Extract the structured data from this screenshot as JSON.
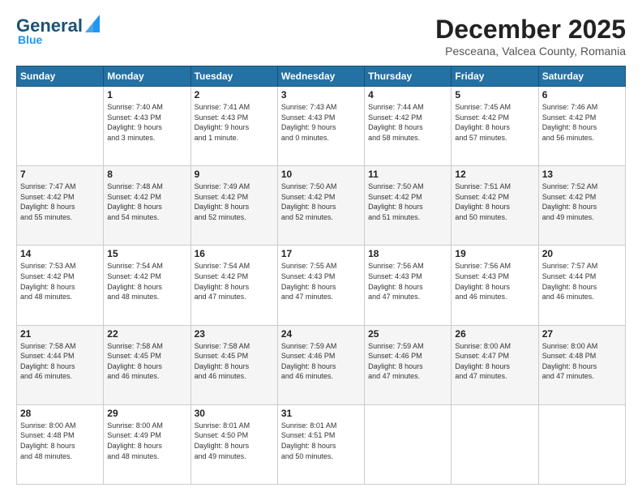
{
  "header": {
    "logo_general": "General",
    "logo_blue": "Blue",
    "month_title": "December 2025",
    "location": "Pesceana, Valcea County, Romania"
  },
  "weekdays": [
    "Sunday",
    "Monday",
    "Tuesday",
    "Wednesday",
    "Thursday",
    "Friday",
    "Saturday"
  ],
  "weeks": [
    [
      {
        "day": "",
        "content": ""
      },
      {
        "day": "1",
        "content": "Sunrise: 7:40 AM\nSunset: 4:43 PM\nDaylight: 9 hours\nand 3 minutes."
      },
      {
        "day": "2",
        "content": "Sunrise: 7:41 AM\nSunset: 4:43 PM\nDaylight: 9 hours\nand 1 minute."
      },
      {
        "day": "3",
        "content": "Sunrise: 7:43 AM\nSunset: 4:43 PM\nDaylight: 9 hours\nand 0 minutes."
      },
      {
        "day": "4",
        "content": "Sunrise: 7:44 AM\nSunset: 4:42 PM\nDaylight: 8 hours\nand 58 minutes."
      },
      {
        "day": "5",
        "content": "Sunrise: 7:45 AM\nSunset: 4:42 PM\nDaylight: 8 hours\nand 57 minutes."
      },
      {
        "day": "6",
        "content": "Sunrise: 7:46 AM\nSunset: 4:42 PM\nDaylight: 8 hours\nand 56 minutes."
      }
    ],
    [
      {
        "day": "7",
        "content": "Sunrise: 7:47 AM\nSunset: 4:42 PM\nDaylight: 8 hours\nand 55 minutes."
      },
      {
        "day": "8",
        "content": "Sunrise: 7:48 AM\nSunset: 4:42 PM\nDaylight: 8 hours\nand 54 minutes."
      },
      {
        "day": "9",
        "content": "Sunrise: 7:49 AM\nSunset: 4:42 PM\nDaylight: 8 hours\nand 52 minutes."
      },
      {
        "day": "10",
        "content": "Sunrise: 7:50 AM\nSunset: 4:42 PM\nDaylight: 8 hours\nand 52 minutes."
      },
      {
        "day": "11",
        "content": "Sunrise: 7:50 AM\nSunset: 4:42 PM\nDaylight: 8 hours\nand 51 minutes."
      },
      {
        "day": "12",
        "content": "Sunrise: 7:51 AM\nSunset: 4:42 PM\nDaylight: 8 hours\nand 50 minutes."
      },
      {
        "day": "13",
        "content": "Sunrise: 7:52 AM\nSunset: 4:42 PM\nDaylight: 8 hours\nand 49 minutes."
      }
    ],
    [
      {
        "day": "14",
        "content": "Sunrise: 7:53 AM\nSunset: 4:42 PM\nDaylight: 8 hours\nand 48 minutes."
      },
      {
        "day": "15",
        "content": "Sunrise: 7:54 AM\nSunset: 4:42 PM\nDaylight: 8 hours\nand 48 minutes."
      },
      {
        "day": "16",
        "content": "Sunrise: 7:54 AM\nSunset: 4:42 PM\nDaylight: 8 hours\nand 47 minutes."
      },
      {
        "day": "17",
        "content": "Sunrise: 7:55 AM\nSunset: 4:43 PM\nDaylight: 8 hours\nand 47 minutes."
      },
      {
        "day": "18",
        "content": "Sunrise: 7:56 AM\nSunset: 4:43 PM\nDaylight: 8 hours\nand 47 minutes."
      },
      {
        "day": "19",
        "content": "Sunrise: 7:56 AM\nSunset: 4:43 PM\nDaylight: 8 hours\nand 46 minutes."
      },
      {
        "day": "20",
        "content": "Sunrise: 7:57 AM\nSunset: 4:44 PM\nDaylight: 8 hours\nand 46 minutes."
      }
    ],
    [
      {
        "day": "21",
        "content": "Sunrise: 7:58 AM\nSunset: 4:44 PM\nDaylight: 8 hours\nand 46 minutes."
      },
      {
        "day": "22",
        "content": "Sunrise: 7:58 AM\nSunset: 4:45 PM\nDaylight: 8 hours\nand 46 minutes."
      },
      {
        "day": "23",
        "content": "Sunrise: 7:58 AM\nSunset: 4:45 PM\nDaylight: 8 hours\nand 46 minutes."
      },
      {
        "day": "24",
        "content": "Sunrise: 7:59 AM\nSunset: 4:46 PM\nDaylight: 8 hours\nand 46 minutes."
      },
      {
        "day": "25",
        "content": "Sunrise: 7:59 AM\nSunset: 4:46 PM\nDaylight: 8 hours\nand 47 minutes."
      },
      {
        "day": "26",
        "content": "Sunrise: 8:00 AM\nSunset: 4:47 PM\nDaylight: 8 hours\nand 47 minutes."
      },
      {
        "day": "27",
        "content": "Sunrise: 8:00 AM\nSunset: 4:48 PM\nDaylight: 8 hours\nand 47 minutes."
      }
    ],
    [
      {
        "day": "28",
        "content": "Sunrise: 8:00 AM\nSunset: 4:48 PM\nDaylight: 8 hours\nand 48 minutes."
      },
      {
        "day": "29",
        "content": "Sunrise: 8:00 AM\nSunset: 4:49 PM\nDaylight: 8 hours\nand 48 minutes."
      },
      {
        "day": "30",
        "content": "Sunrise: 8:01 AM\nSunset: 4:50 PM\nDaylight: 8 hours\nand 49 minutes."
      },
      {
        "day": "31",
        "content": "Sunrise: 8:01 AM\nSunset: 4:51 PM\nDaylight: 8 hours\nand 50 minutes."
      },
      {
        "day": "",
        "content": ""
      },
      {
        "day": "",
        "content": ""
      },
      {
        "day": "",
        "content": ""
      }
    ]
  ]
}
